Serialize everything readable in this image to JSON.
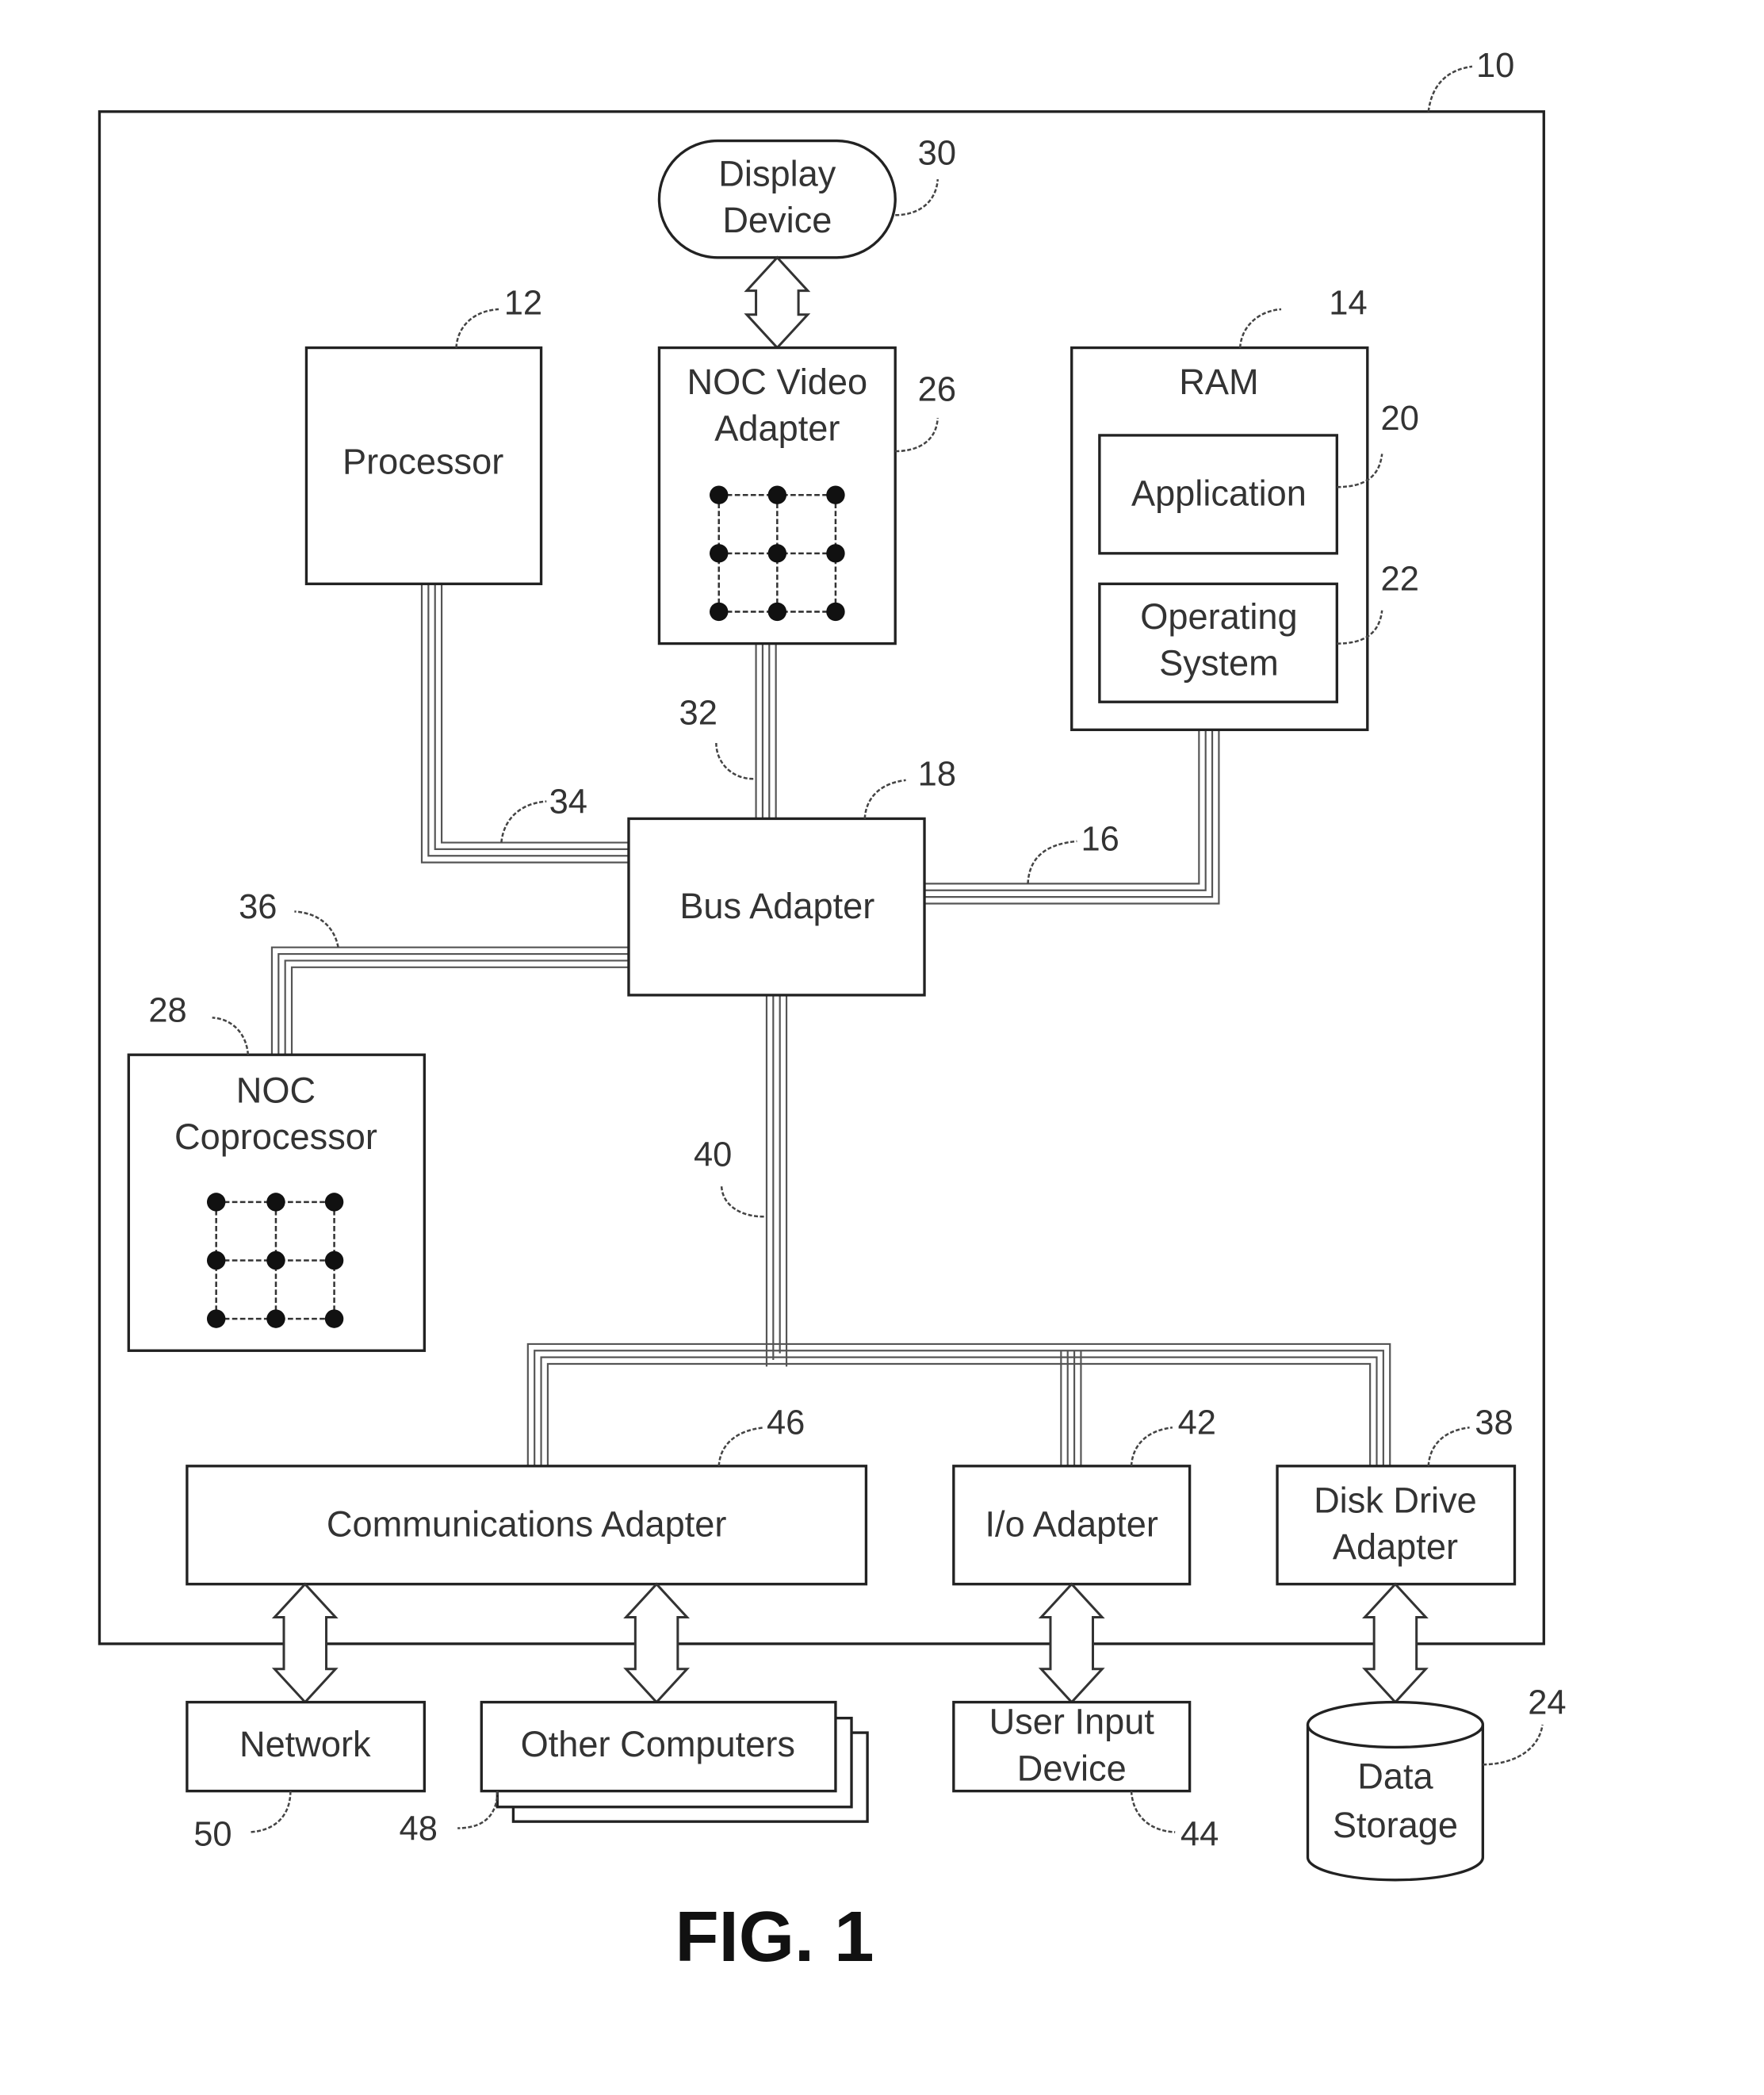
{
  "figure": {
    "caption": "FIG. 1",
    "system_ref": "10"
  },
  "components": {
    "processor": {
      "label": "Processor",
      "ref": "12"
    },
    "ram": {
      "label": "RAM",
      "ref": "14"
    },
    "application": {
      "label": "Application",
      "ref": "20"
    },
    "operating_system": {
      "label_line1": "Operating",
      "label_line2": "System",
      "ref": "22"
    },
    "display_device": {
      "label_line1": "Display",
      "label_line2": "Device",
      "ref": "30"
    },
    "noc_video_adapter": {
      "label_line1": "NOC Video",
      "label_line2": "Adapter",
      "ref": "26"
    },
    "bus_adapter": {
      "label": "Bus Adapter",
      "ref": "18"
    },
    "noc_coprocessor": {
      "label_line1": "NOC",
      "label_line2": "Coprocessor",
      "ref": "28"
    },
    "communications_adapter": {
      "label": "Communications Adapter",
      "ref": "46"
    },
    "io_adapter": {
      "label": "I/o Adapter",
      "ref": "42"
    },
    "disk_drive_adapter": {
      "label_line1": "Disk Drive",
      "label_line2": "Adapter",
      "ref": "38"
    },
    "network": {
      "label": "Network",
      "ref": "50"
    },
    "other_computers": {
      "label": "Other Computers",
      "ref": "48"
    },
    "user_input_device": {
      "label_line1": "User Input",
      "label_line2": "Device",
      "ref": "44"
    },
    "data_storage": {
      "label_line1": "Data",
      "label_line2": "Storage",
      "ref": "24"
    }
  },
  "buses": {
    "memory_bus": {
      "ref": "16"
    },
    "video_bus": {
      "ref": "32"
    },
    "front_side_bus": {
      "ref": "34"
    },
    "coprocessor_bus": {
      "ref": "36"
    },
    "expansion_bus": {
      "ref": "40"
    }
  }
}
